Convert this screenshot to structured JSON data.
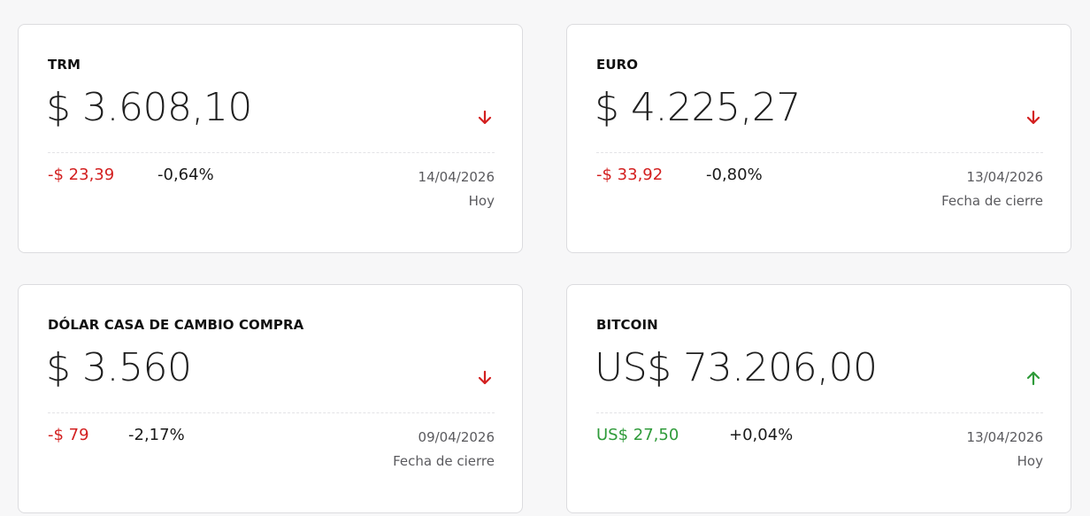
{
  "colors": {
    "down": "#d32020",
    "up": "#2f9b3a"
  },
  "cards": [
    {
      "title": "TRM",
      "value": "$ 3.608,10",
      "trend": "down",
      "trend_icon": "arrow-down-icon",
      "change_abs": "-$ 23,39",
      "change_pct": "-0,64%",
      "date": "14/04/2026",
      "date_note": "Hoy"
    },
    {
      "title": "EURO",
      "value": "$ 4.225,27",
      "trend": "down",
      "trend_icon": "arrow-down-icon",
      "change_abs": "-$ 33,92",
      "change_pct": "-0,80%",
      "date": "13/04/2026",
      "date_note": "Fecha de cierre"
    },
    {
      "title": "DÓLAR CASA DE CAMBIO COMPRA",
      "value": "$ 3.560",
      "trend": "down",
      "trend_icon": "arrow-down-icon",
      "change_abs": "-$ 79",
      "change_pct": "-2,17%",
      "date": "09/04/2026",
      "date_note": "Fecha de cierre"
    },
    {
      "title": "BITCOIN",
      "value": "US$ 73.206,00",
      "trend": "up",
      "trend_icon": "arrow-up-icon",
      "change_abs": "US$ 27,50",
      "change_pct": "+0,04%",
      "date": "13/04/2026",
      "date_note": "Hoy"
    }
  ]
}
